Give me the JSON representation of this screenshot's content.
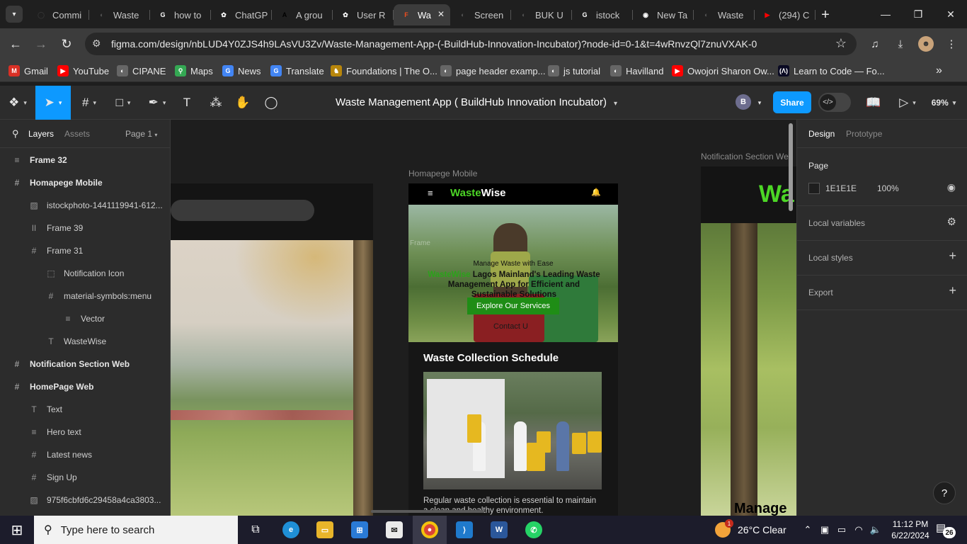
{
  "browser": {
    "tabs": [
      {
        "label": "Commi",
        "icon": "github-icon",
        "color": "#333333",
        "glyph": "◯"
      },
      {
        "label": "Waste",
        "icon": "globe-icon",
        "color": "#555555",
        "glyph": "◐"
      },
      {
        "label": "how to",
        "icon": "google-icon",
        "color": "#ffffff",
        "glyph": "G"
      },
      {
        "label": "ChatGP",
        "icon": "chatgpt-icon",
        "color": "#ffffff",
        "glyph": "✿"
      },
      {
        "label": "A grou",
        "icon": "medium-icon",
        "color": "#000000",
        "glyph": "A"
      },
      {
        "label": "User R",
        "icon": "chatgpt-icon",
        "color": "#ffffff",
        "glyph": "✿"
      },
      {
        "label": "Wa",
        "icon": "figma-icon",
        "color": "#f24e1e",
        "glyph": "F",
        "active": true
      },
      {
        "label": "Screen",
        "icon": "globe-icon",
        "color": "#555555",
        "glyph": "◐"
      },
      {
        "label": "BUK U",
        "icon": "globe-icon",
        "color": "#555555",
        "glyph": "◐"
      },
      {
        "label": "istock",
        "icon": "google-icon",
        "color": "#ffffff",
        "glyph": "G"
      },
      {
        "label": "New Ta",
        "icon": "chrome-icon",
        "color": "#ffffff",
        "glyph": "◉"
      },
      {
        "label": "Waste",
        "icon": "globe-icon",
        "color": "#555555",
        "glyph": "◐"
      },
      {
        "label": "(294) C",
        "icon": "youtube-icon",
        "color": "#ff0000",
        "glyph": "▶"
      }
    ],
    "close_glyph": "✕",
    "newtab_glyph": "+",
    "url": "figma.com/design/nbLUD4Y0ZJS4h9LAsVU3Zv/Waste-Management-App-(-BuildHub-Innovation-Incubator)?node-id=0-1&t=4wRnvzQl7znuVXAK-0",
    "bookmarks": [
      {
        "label": "Gmail",
        "icon": "gmail-icon",
        "color": "#d93025",
        "glyph": "M"
      },
      {
        "label": "YouTube",
        "icon": "youtube-icon",
        "color": "#ff0000",
        "glyph": "▶"
      },
      {
        "label": "CIPANE",
        "icon": "globe-icon",
        "color": "#666666",
        "glyph": "◐"
      },
      {
        "label": "Maps",
        "icon": "maps-icon",
        "color": "#34a853",
        "glyph": "⚲"
      },
      {
        "label": "News",
        "icon": "news-icon",
        "color": "#4285f4",
        "glyph": "G"
      },
      {
        "label": "Translate",
        "icon": "translate-icon",
        "color": "#4285f4",
        "glyph": "G"
      },
      {
        "label": "Foundations | The O...",
        "icon": "odin-icon",
        "color": "#b8860b",
        "glyph": "♞"
      },
      {
        "label": "page header examp...",
        "icon": "globe-icon",
        "color": "#666666",
        "glyph": "◐"
      },
      {
        "label": "js tutorial",
        "icon": "globe-icon",
        "color": "#666666",
        "glyph": "◐"
      },
      {
        "label": "Havilland",
        "icon": "globe-icon",
        "color": "#666666",
        "glyph": "◐"
      },
      {
        "label": "Owojori Sharon Ow...",
        "icon": "youtube-icon",
        "color": "#ff0000",
        "glyph": "▶"
      },
      {
        "label": "Learn to Code — Fo...",
        "icon": "freecodecamp-icon",
        "color": "#0a0a23",
        "glyph": "(Λ)"
      }
    ]
  },
  "figma": {
    "file_title": "Waste Management App ( BuildHub Innovation Incubator)",
    "avatar_initial": "B",
    "share_label": "Share",
    "zoom": "69%",
    "left_panel": {
      "tab_layers": "Layers",
      "tab_assets": "Assets",
      "page_selector": "Page 1",
      "layers": [
        {
          "name": "Frame 32",
          "icon": "≡",
          "indent": 0,
          "top": true
        },
        {
          "name": "Homapege Mobile",
          "icon": "#",
          "indent": 0,
          "top": true
        },
        {
          "name": "istockphoto-1441119941-612...",
          "icon": "▨",
          "indent": 1
        },
        {
          "name": "Frame 39",
          "icon": "ǀǀ",
          "indent": 1
        },
        {
          "name": "Frame 31",
          "icon": "#",
          "indent": 1
        },
        {
          "name": "Notification Icon",
          "icon": "⬚",
          "indent": 2
        },
        {
          "name": "material-symbols:menu",
          "icon": "#",
          "indent": 2
        },
        {
          "name": "Vector",
          "icon": "≡",
          "indent": 3
        },
        {
          "name": "WasteWise",
          "icon": "T",
          "indent": 2
        },
        {
          "name": "Notification Section Web",
          "icon": "#",
          "indent": 0,
          "top": true
        },
        {
          "name": "HomePage Web",
          "icon": "#",
          "indent": 0,
          "top": true
        },
        {
          "name": "Text",
          "icon": "T",
          "indent": 1
        },
        {
          "name": "Hero text",
          "icon": "≡",
          "indent": 1
        },
        {
          "name": "Latest news",
          "icon": "#",
          "indent": 1
        },
        {
          "name": "Sign Up",
          "icon": "#",
          "indent": 1
        },
        {
          "name": "975f6cbfd6c29458a4ca3803...",
          "icon": "▨",
          "indent": 1
        }
      ]
    },
    "canvas": {
      "label_mobile": "Homapege Mobile",
      "label_notification": "Notification Section Web",
      "mobile": {
        "logo_green": "Waste",
        "logo_white": "Wise",
        "menu_glyph": "≡",
        "bell_glyph": "🔔",
        "ghost_label": "Frame",
        "hero_small": "Manage Waste with Ease",
        "hero_green": "WasteWise",
        "hero_title": " Lagos Mainland's Leading Waste Management App for Efficient and Sustainable Solutions",
        "cta": "Explore Our Services",
        "contact": "Contact U",
        "section_title": "Waste Collection Schedule",
        "body": "Regular waste collection is essential to maintain a clean and healthy environment."
      },
      "right_frame": {
        "logo": "Wa",
        "heading": "Manage"
      }
    },
    "right_panel": {
      "tab_design": "Design",
      "tab_prototype": "Prototype",
      "page_heading": "Page",
      "bg_hex": "1E1E1E",
      "opacity": "100%",
      "local_variables": "Local variables",
      "local_styles": "Local styles",
      "export": "Export"
    },
    "help": "?"
  },
  "taskbar": {
    "search_placeholder": "Type here to search",
    "weather": "26°C  Clear",
    "time": "11:12 PM",
    "date": "6/22/2024",
    "notification_count": "26",
    "weather_badge": "1"
  }
}
